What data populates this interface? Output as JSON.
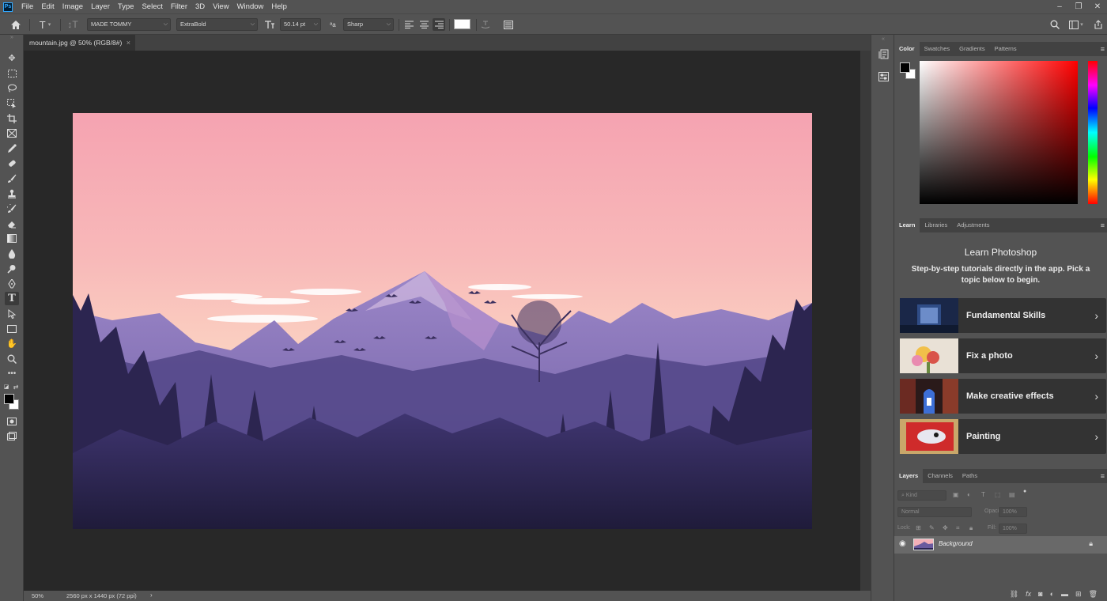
{
  "app": {
    "logo_text": "Ps"
  },
  "menu": [
    "File",
    "Edit",
    "Image",
    "Layer",
    "Type",
    "Select",
    "Filter",
    "3D",
    "View",
    "Window",
    "Help"
  ],
  "window_controls": {
    "minimize": "–",
    "restore": "❐",
    "close": "✕"
  },
  "options_bar": {
    "font_family": "MADE TOMMY",
    "font_style": "ExtraBold",
    "font_size": "50.14 pt",
    "antialias": "Sharp",
    "text_color": "#ffffff"
  },
  "document": {
    "tab_title": "mountain.jpg @ 50% (RGB/8#)",
    "close": "×"
  },
  "status_bar": {
    "zoom": "50%",
    "doc_info": "2560 px x 1440 px (72 ppi)",
    "arrow": "›"
  },
  "color_panel": {
    "tabs": [
      "Color",
      "Swatches",
      "Gradients",
      "Patterns"
    ],
    "foreground": "#000000",
    "background": "#ffffff"
  },
  "learn_panel": {
    "tabs": [
      "Learn",
      "Libraries",
      "Adjustments"
    ],
    "title": "Learn Photoshop",
    "description": "Step-by-step tutorials directly in the app. Pick a topic below to begin.",
    "cards": [
      {
        "label": "Fundamental Skills"
      },
      {
        "label": "Fix a photo"
      },
      {
        "label": "Make creative effects"
      },
      {
        "label": "Painting"
      }
    ]
  },
  "layers_panel": {
    "tabs": [
      "Layers",
      "Channels",
      "Paths"
    ],
    "filter_placeholder": "Kind",
    "blend_mode": "Normal",
    "opacity_label": "Opacity:",
    "opacity_value": "100%",
    "lock_label": "Lock:",
    "fill_label": "Fill:",
    "fill_value": "100%",
    "layers": [
      {
        "name": "Background",
        "visible": true,
        "locked": true
      }
    ]
  }
}
